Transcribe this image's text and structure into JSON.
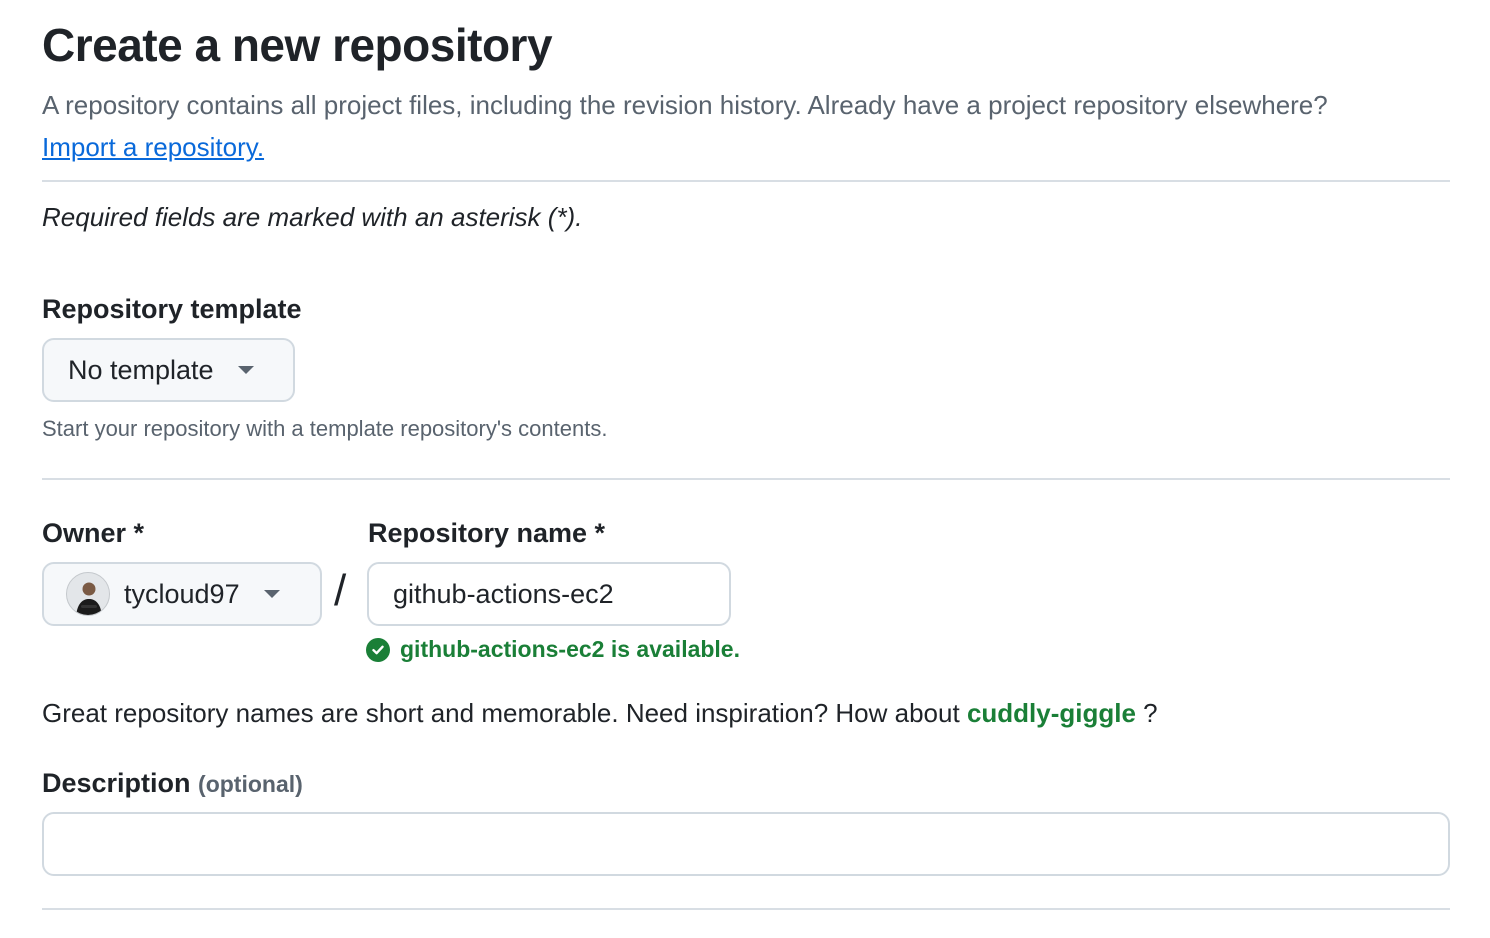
{
  "header": {
    "title": "Create a new repository",
    "subtitle_text": "A repository contains all project files, including the revision history. Already have a project repository elsewhere?",
    "import_link": "Import a repository."
  },
  "required_note": "Required fields are marked with an asterisk (*).",
  "template": {
    "label": "Repository template",
    "selected": "No template",
    "hint": "Start your repository with a template repository's contents."
  },
  "owner": {
    "label": "Owner *",
    "selected": "tycloud97"
  },
  "separator": "/",
  "repo_name": {
    "label": "Repository name *",
    "value": "github-actions-ec2",
    "availability": "github-actions-ec2 is available."
  },
  "inspiration": {
    "text": "Great repository names are short and memorable. Need inspiration? How about",
    "suggestion": "cuddly-giggle",
    "suffix": "?"
  },
  "description": {
    "label": "Description",
    "optional": "(optional)",
    "value": ""
  },
  "colors": {
    "link": "#0969da",
    "success": "#1a7f37",
    "border": "#d1d9e0",
    "button_bg": "#f6f8fa",
    "muted_text": "#59636e"
  },
  "icons": {
    "caret": "chevron-down-icon",
    "check": "check-circle-icon",
    "avatar": "user-avatar"
  }
}
